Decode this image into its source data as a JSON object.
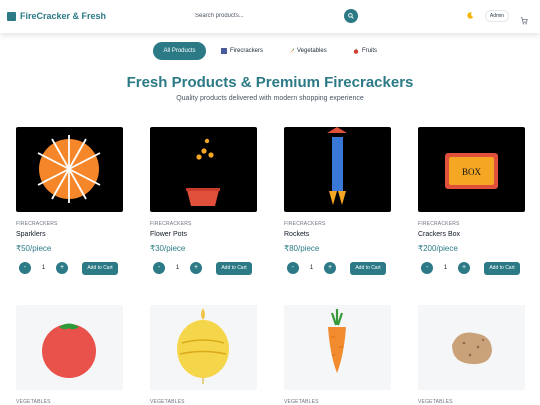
{
  "header": {
    "brand": "FireCracker & Fresh",
    "search_placeholder": "Search products...",
    "admin_label": "Admin"
  },
  "categories": [
    {
      "label": "All Products",
      "icon": "",
      "active": true
    },
    {
      "label": "Firecrackers",
      "icon": "firecracker-icon",
      "active": false
    },
    {
      "label": "Vegetables",
      "icon": "carrot-icon",
      "active": false
    },
    {
      "label": "Fruits",
      "icon": "apple-icon",
      "active": false
    }
  ],
  "hero": {
    "title": "Fresh Products & Premium Firecrackers",
    "subtitle": "Quality products delivered with modern shopping experience"
  },
  "products": [
    {
      "category": "FIRECRACKERS",
      "name": "Sparklers",
      "price": "₹50/piece",
      "qty": "1",
      "button": "Add to Cart",
      "image": "sparkler-wheel-icon"
    },
    {
      "category": "FIRECRACKERS",
      "name": "Flower Pots",
      "price": "₹30/piece",
      "qty": "1",
      "button": "Add to Cart",
      "image": "flower-pot-icon"
    },
    {
      "category": "FIRECRACKERS",
      "name": "Rockets",
      "price": "₹80/piece",
      "qty": "1",
      "button": "Add to Cart",
      "image": "rocket-icon"
    },
    {
      "category": "FIRECRACKERS",
      "name": "Crackers Box",
      "price": "₹200/piece",
      "qty": "1",
      "button": "Add to Cart",
      "image": "crackers-box-icon",
      "image_text": "BOX"
    },
    {
      "category": "VEGETABLES",
      "image": "tomato-icon"
    },
    {
      "category": "VEGETABLES",
      "image": "onion-icon"
    },
    {
      "category": "VEGETABLES",
      "image": "carrot-icon"
    },
    {
      "category": "VEGETABLES",
      "image": "potato-icon"
    }
  ],
  "colors": {
    "accent": "#2b7a86",
    "card_dark": "#000000",
    "card_light": "#f5f6f8"
  }
}
